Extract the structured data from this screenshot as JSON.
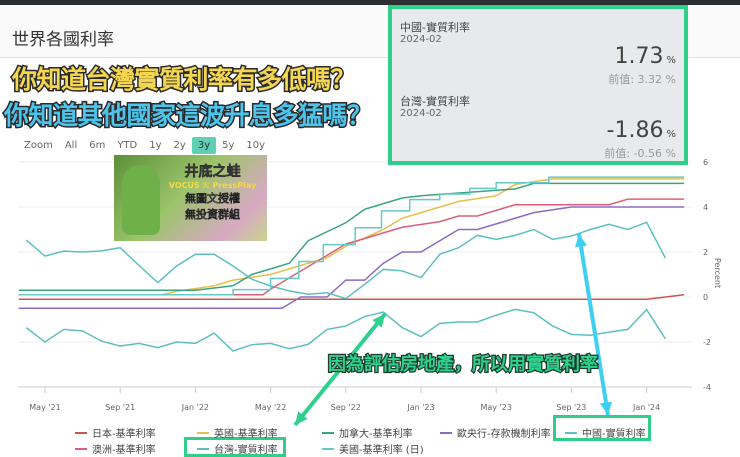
{
  "header": {
    "title": "世界各國利率"
  },
  "overlay": {
    "line1": "你知道台灣實質利率有多低嗎？",
    "line2": "你知道其他國家這波升息多猛嗎？",
    "annotation": "因為評估房地產，所以用實質利率"
  },
  "zoom": {
    "label": "Zoom",
    "options": [
      "All",
      "6m",
      "YTD",
      "1y",
      "2y",
      "3y",
      "5y",
      "10y"
    ],
    "active": "3y"
  },
  "watermark": {
    "title": "井底之蛙",
    "brand": "VOCUS ☒ PressPlay",
    "line1": "無圖文授權",
    "line2": "無投資群組"
  },
  "tooltip": [
    {
      "name": "中國-實質利率",
      "date": "2024-02",
      "value": "1.73",
      "unit": "%",
      "prev": "前值: 3.32 %"
    },
    {
      "name": "台灣-實質利率",
      "date": "2024-02",
      "value": "-1.86",
      "unit": "%",
      "prev": "前值: -0.56 %"
    }
  ],
  "chart_data": {
    "type": "line",
    "ylabel": "Percent",
    "ylim": [
      -4,
      6
    ],
    "yticks": [
      "6",
      "4",
      "2",
      "0",
      "-2",
      "-4"
    ],
    "xticks": [
      "May '21",
      "Sep '21",
      "Jan '22",
      "May '22",
      "Sep '22",
      "Jan '23",
      "May '23",
      "Sep '23",
      "Jan '24"
    ],
    "x_unit": "months since May 2021",
    "series": [
      {
        "name": "日本-基準利率",
        "color": "#c8574f",
        "points": [
          [
            -1.4,
            -0.1
          ],
          [
            32,
            -0.1
          ],
          [
            34,
            0.1
          ]
        ]
      },
      {
        "name": "英國-基準利率",
        "color": "#e6c04d",
        "points": [
          [
            -1.4,
            0.1
          ],
          [
            6.2,
            0.1
          ],
          [
            7,
            0.25
          ],
          [
            9,
            0.5
          ],
          [
            10,
            0.75
          ],
          [
            12,
            1.0
          ],
          [
            13,
            1.25
          ],
          [
            15,
            1.75
          ],
          [
            16,
            2.25
          ],
          [
            18,
            3.0
          ],
          [
            19,
            3.5
          ],
          [
            21,
            4.0
          ],
          [
            22,
            4.25
          ],
          [
            24,
            4.5
          ],
          [
            25,
            5.0
          ],
          [
            27,
            5.25
          ],
          [
            34,
            5.25
          ]
        ]
      },
      {
        "name": "加拿大-基準利率",
        "color": "#3aa57f",
        "points": [
          [
            -1.4,
            0.3
          ],
          [
            8,
            0.3
          ],
          [
            10,
            0.5
          ],
          [
            11,
            1.0
          ],
          [
            13,
            1.5
          ],
          [
            14,
            2.5
          ],
          [
            16,
            3.3
          ],
          [
            17,
            3.9
          ],
          [
            19,
            4.4
          ],
          [
            20,
            4.5
          ],
          [
            25,
            4.8
          ],
          [
            26,
            5.05
          ],
          [
            34,
            5.05
          ]
        ]
      },
      {
        "name": "歐央行-存款機制利率",
        "color": "#8b6bc2",
        "points": [
          [
            -1.4,
            -0.5
          ],
          [
            12.6,
            -0.5
          ],
          [
            13.6,
            0
          ],
          [
            15,
            0
          ],
          [
            16,
            0.75
          ],
          [
            17,
            0.75
          ],
          [
            18,
            1.5
          ],
          [
            19,
            2.0
          ],
          [
            20,
            2.0
          ],
          [
            21,
            2.5
          ],
          [
            22,
            3.0
          ],
          [
            23,
            3.0
          ],
          [
            24,
            3.25
          ],
          [
            25,
            3.5
          ],
          [
            26,
            3.75
          ],
          [
            28,
            4.0
          ],
          [
            34,
            4.0
          ]
        ]
      },
      {
        "name": "中國-實質利率",
        "color": "#5ebfc0",
        "monthly_start": -1,
        "values": [
          2.53,
          1.82,
          2.04,
          2.0,
          2.05,
          2.19,
          1.4,
          0.64,
          1.38,
          1.9,
          1.9,
          1.38,
          0.79,
          0.49,
          0.27,
          0.12,
          0.19,
          -0.07,
          0.56,
          1.23,
          1.16,
          0.86,
          1.9,
          2.19,
          2.74,
          2.56,
          2.74,
          3.0,
          2.56,
          2.71,
          3.0,
          3.23,
          3.0,
          3.32,
          1.73
        ]
      },
      {
        "name": "澳洲-基準利率",
        "color": "#d9607a",
        "points": [
          [
            -1.4,
            0.1
          ],
          [
            11.6,
            0.1
          ],
          [
            12,
            0.35
          ],
          [
            13,
            0.85
          ],
          [
            14,
            1.35
          ],
          [
            15,
            1.85
          ],
          [
            16,
            2.35
          ],
          [
            17,
            2.6
          ],
          [
            18,
            2.85
          ],
          [
            19,
            3.1
          ],
          [
            21,
            3.35
          ],
          [
            22,
            3.6
          ],
          [
            23,
            3.6
          ],
          [
            24,
            3.85
          ],
          [
            25,
            4.1
          ],
          [
            30,
            4.1
          ],
          [
            31,
            4.35
          ],
          [
            34,
            4.35
          ]
        ]
      },
      {
        "name": "台灣-實質利率",
        "color": "#5ebfc0",
        "monthly_start": -1,
        "values": [
          -1.36,
          -2.0,
          -1.44,
          -1.51,
          -1.96,
          -2.18,
          -2.06,
          -2.25,
          -2.0,
          -2.06,
          -1.61,
          -2.4,
          -2.12,
          -2.06,
          -2.3,
          -2.1,
          -1.44,
          -1.29,
          -0.87,
          -0.67,
          -1.36,
          -1.76,
          -1.17,
          -1.11,
          -1.11,
          -0.81,
          -0.55,
          -0.7,
          -1.29,
          -1.66,
          -1.7,
          -1.56,
          -1.44,
          -0.56,
          -1.86
        ]
      },
      {
        "name": "美國-基準利率 (日)",
        "color": "#66c9c9",
        "step": true,
        "points": [
          [
            -1.4,
            0.1
          ],
          [
            10,
            0.33
          ],
          [
            12,
            0.83
          ],
          [
            13.5,
            1.58
          ],
          [
            14.8,
            2.33
          ],
          [
            16.5,
            3.08
          ],
          [
            17.9,
            3.83
          ],
          [
            19.4,
            4.33
          ],
          [
            21,
            4.58
          ],
          [
            22.6,
            4.83
          ],
          [
            24,
            5.08
          ],
          [
            26.8,
            5.33
          ],
          [
            34,
            5.33
          ]
        ]
      }
    ]
  },
  "legend": [
    "日本-基準利率",
    "英國-基準利率",
    "加拿大-基準利率",
    "歐央行-存款機制利率",
    "中國-實質利率",
    "澳洲-基準利率",
    "台灣-實質利率",
    "美國-基準利率 (日)"
  ]
}
